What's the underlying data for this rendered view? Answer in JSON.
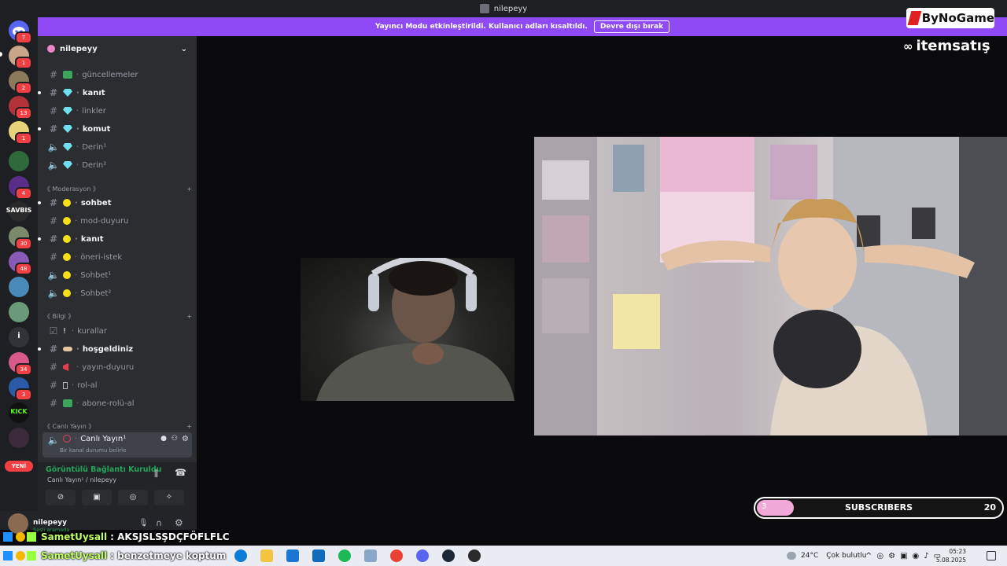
{
  "window": {
    "title": "nilepeyy"
  },
  "banner": {
    "text": "Yayıncı Modu etkinleştirildi. Kullanıcı adları kısaltıldı.",
    "button": "Devre dışı bırak"
  },
  "servers": {
    "badges": [
      "7",
      "1",
      "2",
      "13",
      "1",
      "4",
      "30",
      "48",
      "34",
      "3"
    ],
    "labels": {
      "savbis": "SAVBIS",
      "kick": "KICK",
      "info": "i"
    },
    "new_label": "YENİ"
  },
  "sidebar": {
    "server_name": "nilepeyy",
    "channels": [
      {
        "name": "güncellemeler"
      },
      {
        "name": "kanıt"
      },
      {
        "name": "linkler"
      },
      {
        "name": "komut"
      },
      {
        "name": "Derin¹"
      },
      {
        "name": "Derin²"
      },
      {
        "name": "sohbet"
      },
      {
        "name": "mod-duyuru"
      },
      {
        "name": "kanıt"
      },
      {
        "name": "öneri-istek"
      },
      {
        "name": "Sohbet¹"
      },
      {
        "name": "Sohbet²"
      },
      {
        "name": "kurallar"
      },
      {
        "name": "hoşgeldiniz"
      },
      {
        "name": "yayın-duyuru"
      },
      {
        "name": "rol-al"
      },
      {
        "name": "abone-rolü-al"
      },
      {
        "name": "Canlı Yayın¹",
        "status": "Bir kanal durumu belirle"
      }
    ],
    "categories": [
      "《 Moderasyon 》",
      "《 Bilgi 》",
      "《 Canlı Yayın 》"
    ]
  },
  "voice": {
    "status": "Görüntülü Bağlantı Kuruldu",
    "channel": "Canlı Yayın¹ / nilepeyy"
  },
  "user": {
    "name": "nilepeyy",
    "status": "Sesli aramada"
  },
  "chat_overlay": [
    {
      "user": "SametUysall",
      "message": ": AKSJSLSŞDÇFÖFLFLC"
    },
    {
      "user": "SametUysall",
      "message": ": benzetmeye koptum"
    }
  ],
  "sponsors": {
    "bynogame": "ByNoGame",
    "itemsatis": "itemsatış"
  },
  "subscribers": {
    "label": "SUBSCRIBERS",
    "current": 3,
    "goal": 20
  },
  "taskbar": {
    "weather": "24°C",
    "weather_desc": "Çok bulutlu",
    "time": "05:23",
    "date": "5.08.2025"
  },
  "colors": {
    "accent": "#8f4af5",
    "sidebar": "#2b2d31",
    "servers": "#1e1f22",
    "online": "#23a55a"
  }
}
